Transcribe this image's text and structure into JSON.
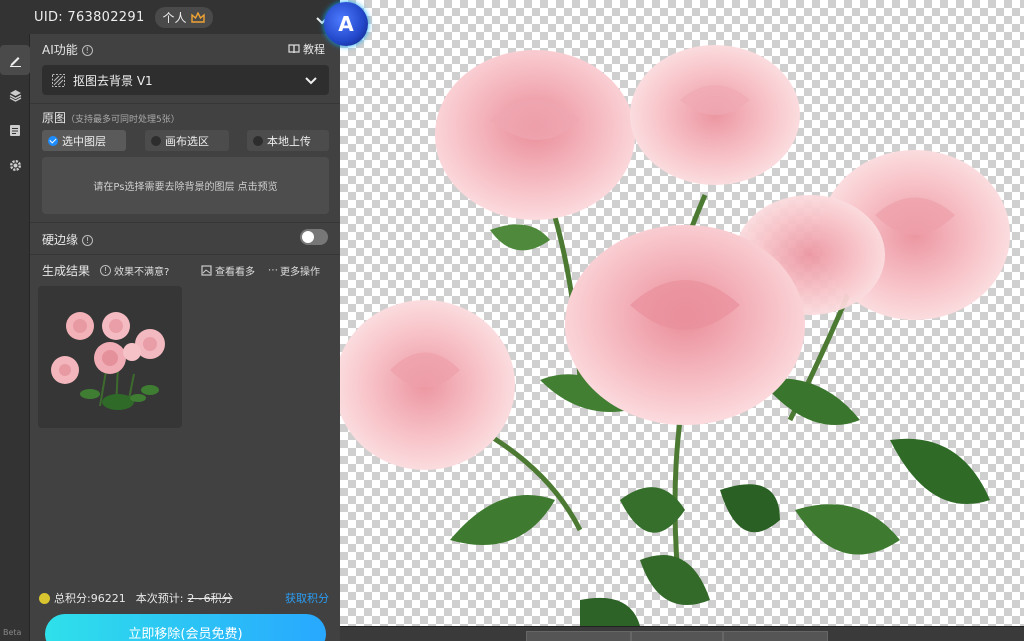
{
  "header": {
    "uid_label": "UID: 763802291",
    "persona_label": "个人"
  },
  "ai_function": {
    "title": "AI功能",
    "tutorial_label": "教程",
    "selected_function": "抠图去背景 V1"
  },
  "source": {
    "title": "原图",
    "hint": "（支持最多可同时处理5张）",
    "options": [
      "选中图层",
      "画布选区",
      "本地上传"
    ],
    "selected_option": "选中图层",
    "drop_hint": "请在Ps选择需要去除背景的图层 点击预览"
  },
  "hard_edge": {
    "label": "硬边缘",
    "enabled": false
  },
  "results": {
    "title": "生成结果",
    "feedback_label": "效果不满意?",
    "view_more_label": "查看看多",
    "more_actions_label": "更多操作"
  },
  "footer": {
    "total_points_label": "总积分:96221",
    "estimate_label": "本次预计:",
    "estimate_value": "2~6积分",
    "get_points_label": "获取积分",
    "remove_button_label": "立即移除(会员免费)"
  },
  "rail": {
    "beta_label": "Beta",
    "icons": [
      "brush-icon",
      "layers-icon",
      "document-icon",
      "gear-icon"
    ]
  },
  "colors": {
    "panel_bg": "#414141",
    "accent_blue": "#2a9df4",
    "button_gradient_start": "#2fe0ea",
    "button_gradient_end": "#28a8ff",
    "coin_yellow": "#d9c52f"
  }
}
